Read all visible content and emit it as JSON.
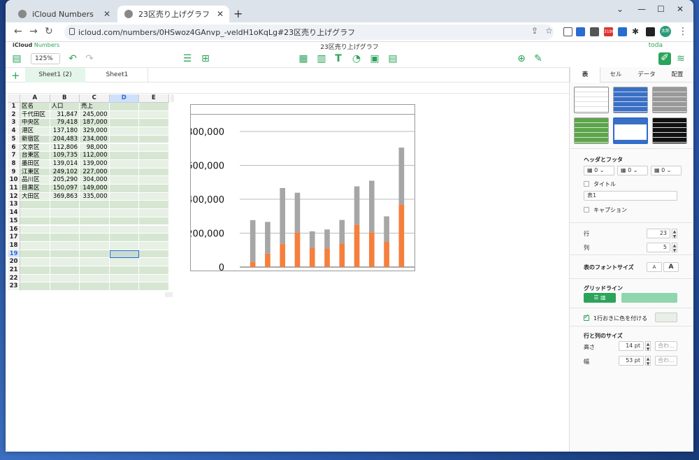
{
  "browser": {
    "tabs": [
      {
        "label": "iCloud Numbers"
      },
      {
        "label": "23区売り上げグラフ"
      }
    ],
    "url": "icloud.com/numbers/0HSwoz4GAnvp_-veldH1oKqLg#23区売り上げグラフ",
    "mail_badge": "3190",
    "profile_label": "太郎"
  },
  "app": {
    "brand_icloud": "iCloud",
    "brand_numbers": "Numbers",
    "doc_title": "23区売り上げグラフ",
    "user": "toda",
    "zoom": "125%",
    "sheets": [
      {
        "label": "Sheet1 (2)",
        "active": true
      },
      {
        "label": "Sheet1",
        "active": false
      }
    ]
  },
  "table": {
    "columns": [
      "A",
      "B",
      "C",
      "D",
      "E"
    ],
    "selected_column": "D",
    "selected_row": 19,
    "row_numbers": [
      "1",
      "2",
      "3",
      "4",
      "5",
      "6",
      "7",
      "8",
      "9",
      "10",
      "11",
      "12",
      "13",
      "14",
      "15",
      "16",
      "17",
      "18",
      "19",
      "20",
      "21",
      "22",
      "23"
    ],
    "header": [
      "区名",
      "人口",
      "売上"
    ],
    "rows": [
      [
        "千代田区",
        "31,847",
        "245,000"
      ],
      [
        "中央区",
        "79,418",
        "187,000"
      ],
      [
        "港区",
        "137,180",
        "329,000"
      ],
      [
        "新宿区",
        "204,483",
        "234,000"
      ],
      [
        "文京区",
        "112,806",
        "98,000"
      ],
      [
        "台東区",
        "109,735",
        "112,000"
      ],
      [
        "墨田区",
        "139,014",
        "139,000"
      ],
      [
        "江東区",
        "249,102",
        "227,000"
      ],
      [
        "品川区",
        "205,290",
        "304,000"
      ],
      [
        "目黒区",
        "150,097",
        "149,000"
      ],
      [
        "大田区",
        "369,863",
        "335,000"
      ]
    ]
  },
  "chart_data": {
    "type": "bar",
    "stacked": true,
    "categories": [
      "千代田区",
      "中央区",
      "港区",
      "新宿区",
      "文京区",
      "台東区",
      "墨田区",
      "江東区",
      "品川区",
      "目黒区",
      "大田区"
    ],
    "series": [
      {
        "values": [
          31847,
          79418,
          137180,
          204483,
          112806,
          109735,
          139014,
          249102,
          205290,
          150097,
          369863
        ],
        "color": "#f57f3c"
      },
      {
        "values": [
          245000,
          187000,
          329000,
          234000,
          98000,
          112000,
          139000,
          227000,
          304000,
          149000,
          335000
        ],
        "color": "#a6a6a6"
      }
    ],
    "ylim": [
      0,
      800000
    ],
    "yticks": [
      "800,000",
      "600,000",
      "400,000",
      "200,000",
      "0"
    ],
    "ytick_values": [
      800000,
      600000,
      400000,
      200000,
      0
    ],
    "grid": true
  },
  "panel": {
    "tabs": [
      "表",
      "セル",
      "データ",
      "配置"
    ],
    "header_footer_label": "ヘッダとフッタ",
    "header_values": [
      "0",
      "0",
      "0"
    ],
    "title_label": "タイトル",
    "table_name": "表1",
    "caption_label": "キャプション",
    "rows_label": "行",
    "rows_value": "23",
    "cols_label": "列",
    "cols_value": "5",
    "font_size_label": "表のフォントサイズ",
    "font_small": "A",
    "font_large": "A",
    "gridlines_label": "グリッドライン",
    "alt_rows_label": "1行おきに色を付ける",
    "row_col_size_label": "行と列のサイズ",
    "height_label": "高さ",
    "height_value": "14 pt",
    "width_label": "幅",
    "width_value": "53 pt",
    "fit_label": "合わ..."
  }
}
